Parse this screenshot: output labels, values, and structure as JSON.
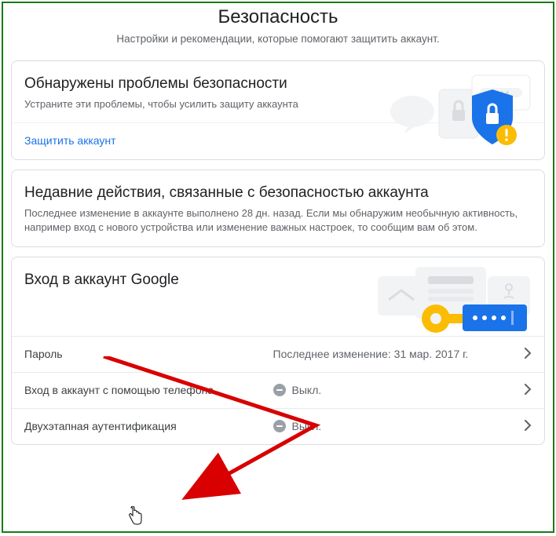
{
  "header": {
    "title": "Безопасность",
    "subtitle": "Настройки и рекомендации, которые помогают защитить аккаунт."
  },
  "security_issues": {
    "title": "Обнаружены проблемы безопасности",
    "subtitle": "Устраните эти проблемы, чтобы усилить защиту аккаунта",
    "link": "Защитить аккаунт"
  },
  "recent": {
    "title": "Недавние действия, связанные с безопасностью аккаунта",
    "body": "Последнее изменение в аккаунте выполнено 28 дн. назад. Если мы обнаружим необычную активность, например вход с нового устройства или изменение важных настроек, то сообщим вам об этом."
  },
  "signin": {
    "title": "Вход в аккаунт Google",
    "rows": [
      {
        "label": "Пароль",
        "value": "Последнее изменение: 31 мар. 2017 г.",
        "off_icon": false
      },
      {
        "label": "Вход в аккаунт с помощью телефона",
        "value": "Выкл.",
        "off_icon": true
      },
      {
        "label": "Двухэтапная аутентификация",
        "value": "Выкл.",
        "off_icon": true
      }
    ]
  }
}
